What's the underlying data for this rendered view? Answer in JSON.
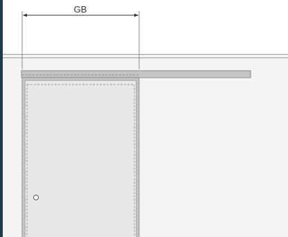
{
  "dimension": {
    "label": "GB"
  },
  "colors": {
    "background": "#1f3a4b",
    "wall": "#f4f4f4",
    "door": "#e8e8e8",
    "rail": "#c4c4c4",
    "line": "#8a8a8a"
  }
}
